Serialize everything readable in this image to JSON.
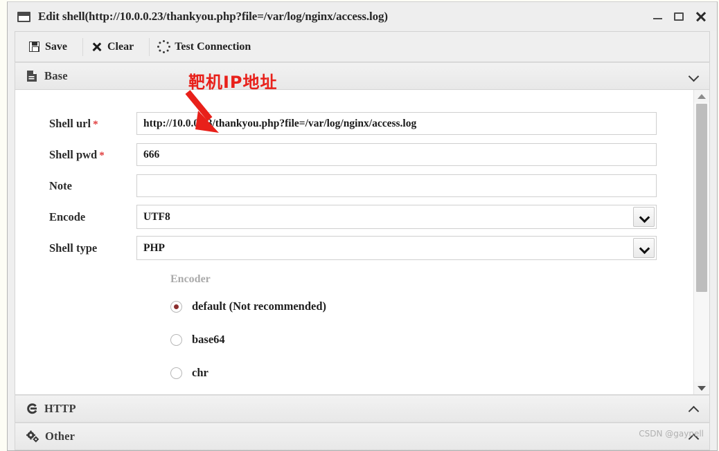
{
  "window": {
    "title": "Edit shell(http://10.0.0.23/thankyou.php?file=/var/log/nginx/access.log)",
    "title_icon": "window-icon",
    "controls": {
      "minimize": "minimize-icon",
      "maximize": "maximize-icon",
      "close": "close-icon"
    }
  },
  "toolbar": {
    "save_label": "Save",
    "clear_label": "Clear",
    "test_label": "Test Connection",
    "save_icon": "floppy-disk-icon",
    "clear_icon": "x-mark-icon",
    "test_icon": "spinner-icon"
  },
  "sections": {
    "base": {
      "label": "Base",
      "icon": "document-icon",
      "state": "expanded",
      "chevron": "chevron-down-icon"
    },
    "http": {
      "label": "HTTP",
      "icon": "exchange-icon",
      "state": "collapsed",
      "chevron": "chevron-up-icon"
    },
    "other": {
      "label": "Other",
      "icon": "gears-icon",
      "state": "collapsed",
      "chevron": "chevron-up-icon"
    }
  },
  "form": {
    "fields": [
      {
        "label": "Shell url",
        "required": true,
        "value": "http://10.0.0.23/thankyou.php?file=/var/log/nginx/access.log",
        "placeholder": ""
      },
      {
        "label": "Shell pwd",
        "required": true,
        "value": "666",
        "placeholder": ""
      },
      {
        "label": "Note",
        "required": false,
        "value": "",
        "placeholder": ""
      }
    ],
    "selects": [
      {
        "label": "Encode",
        "value": "UTF8",
        "chevron": "chevron-down-icon"
      },
      {
        "label": "Shell type",
        "value": "PHP",
        "chevron": "chevron-down-icon"
      }
    ],
    "encoder": {
      "title": "Encoder",
      "options": [
        {
          "label": "default (Not recommended)",
          "selected": true
        },
        {
          "label": "base64",
          "selected": false
        },
        {
          "label": "chr",
          "selected": false
        }
      ]
    }
  },
  "annotation": {
    "text": "靶机IP地址",
    "color": "#e8201a",
    "arrow": "down-right-arrow"
  },
  "watermark": "CSDN @gaynell",
  "colors": {
    "required_star": "#e03b3b",
    "annotation_red": "#e8201a",
    "radio_dot": "#8b2f2f",
    "window_bg": "#efefef"
  }
}
